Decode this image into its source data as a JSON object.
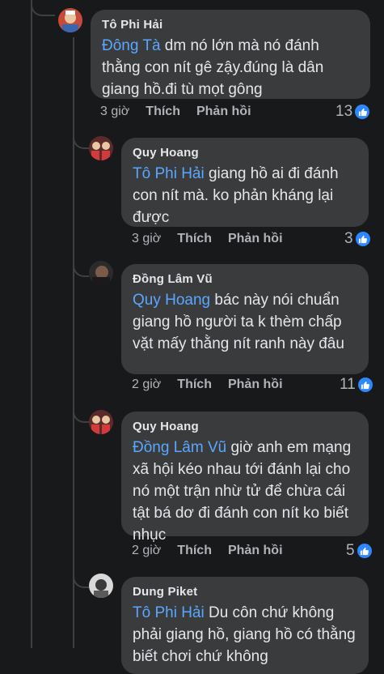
{
  "comments": [
    {
      "author": "Tô Phi Hải",
      "mention": "Đông Tà",
      "text": " dm nó lớn mà nó đánh thằng con nít gê zậy.đúng là dân giang hồ.đi tù mọt gông",
      "time": "3 giờ",
      "like_label": "Thích",
      "reply_label": "Phản hồi",
      "reactions": "13",
      "avatar_icon": "avatar-icon"
    },
    {
      "author": "Quy Hoang",
      "mention": "Tô Phi Hải",
      "text": " giang hồ ai đi đánh con nít mà. ko phản kháng lại được",
      "time": "3 giờ",
      "like_label": "Thích",
      "reply_label": "Phản hồi",
      "reactions": "3",
      "avatar_icon": "avatar-icon"
    },
    {
      "author": "Đồng Lâm Vũ",
      "mention": "Quy Hoang",
      "text": " bác này nói chuẩn giang hồ người ta k thèm chấp vặt mấy thằng nít ranh này đâu",
      "time": "2 giờ",
      "like_label": "Thích",
      "reply_label": "Phản hồi",
      "reactions": "11",
      "avatar_icon": "avatar-icon"
    },
    {
      "author": "Quy Hoang",
      "mention": "Đồng Lâm Vũ",
      "text": " giờ anh em mạng xã hội kéo nhau tới đánh lại cho nó một trận nhừ tử để chừa cái tật bá dơ đi đánh con nít ko biết nhục",
      "time": "2 giờ",
      "like_label": "Thích",
      "reply_label": "Phản hồi",
      "reactions": "5",
      "avatar_icon": "avatar-icon"
    },
    {
      "author": "Dung Piket",
      "mention": "Tô Phi Hải",
      "text": " Du côn chứ không phải giang hồ, giang hồ có thằng biết chơi chứ không",
      "avatar_icon": "avatar-icon"
    }
  ],
  "colors": {
    "background": "#18191a",
    "bubble": "#3a3b3c",
    "mention": "#5aa7ff",
    "like_badge": "#2d88ff",
    "meta_text": "#b0b3b8"
  }
}
